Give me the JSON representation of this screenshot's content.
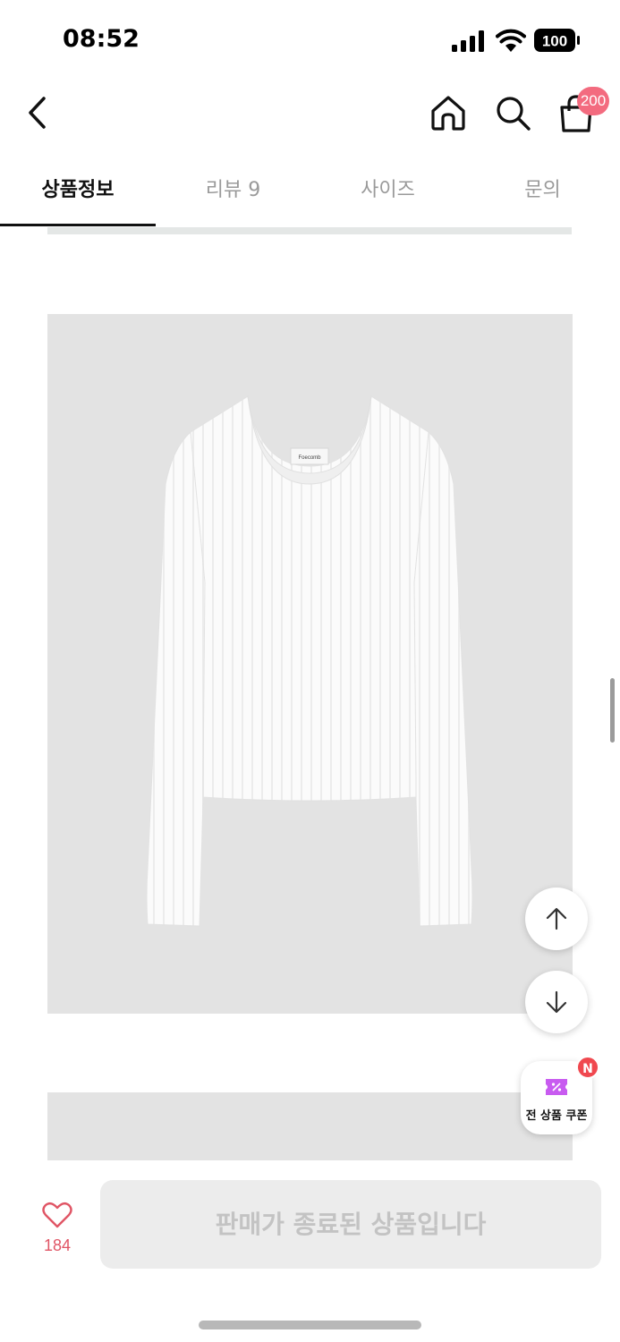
{
  "status_bar": {
    "time": "08:52",
    "battery": "100",
    "icons": [
      "signal-icon",
      "wifi-icon",
      "battery-icon"
    ]
  },
  "header": {
    "icons": [
      "back-arrow-icon",
      "home-icon",
      "search-icon",
      "shopping-bag-icon"
    ],
    "cart_badge": "200"
  },
  "tabs": [
    {
      "label": "상품정보",
      "active": true
    },
    {
      "label": "리뷰 9",
      "active": false
    },
    {
      "label": "사이즈",
      "active": false
    },
    {
      "label": "문의",
      "active": false
    }
  ],
  "product": {
    "label_text": "Foecomb"
  },
  "floating": {
    "up_icon": "arrow-up-icon",
    "down_icon": "arrow-down-icon",
    "coupon_label": "전 상품 쿠폰",
    "coupon_badge": "N"
  },
  "bottom_bar": {
    "like_count": "184",
    "soldout_label": "판매가 종료된 상품입니다"
  },
  "colors": {
    "accent_pink": "#f36b7f",
    "like_red": "#e05565",
    "badge_red": "#f0484f",
    "coupon_purple": "#c85bf0"
  }
}
